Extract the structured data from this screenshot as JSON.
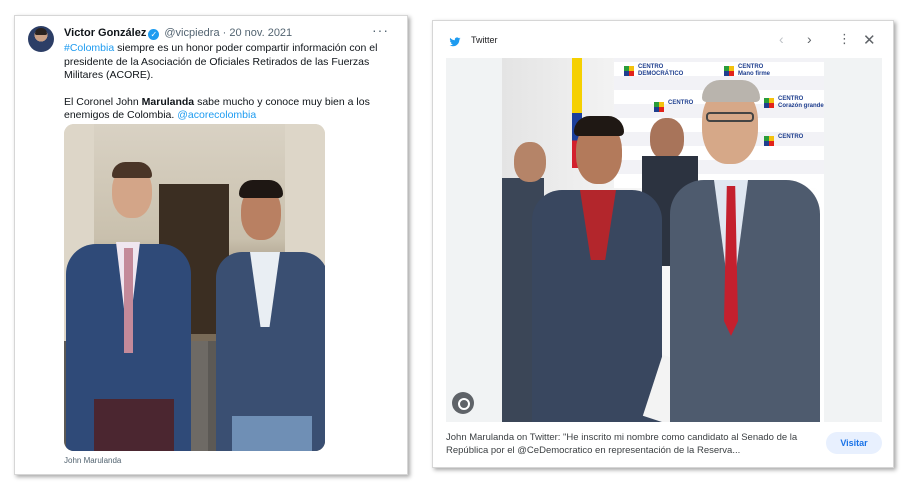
{
  "tweet": {
    "author_name": "Victor González",
    "handle": "@vicpiedra",
    "separator": " · ",
    "date": "20 nov. 2021",
    "more_label": "···",
    "paragraph1": {
      "hashtag": "#Colombia",
      "text": " siempre es un honor poder compartir información con el presidente de la Asociación de Oficiales Retirados de las Fuerzas Militares (ACORE)."
    },
    "paragraph2": {
      "pre": "El Coronel John ",
      "bold": "Marulanda",
      "post": " sabe mucho y conoce muy bien a los enemigos de Colombia. ",
      "mention": "@acorecolombia"
    },
    "photo_caption": "John Marulanda"
  },
  "viewer": {
    "source_label": "Twitter",
    "controls": {
      "prev": "‹",
      "next": "›",
      "menu": "⋮",
      "close": "✕"
    },
    "image_title": "John Marulanda on Twitter: \"He inscrito mi nombre como candidato al Senado de la República por el @CeDemocratico en representación de la Reserva...",
    "visit_label": "Visitar",
    "banner_lines": [
      "CENTRO",
      "DEMOCRÁTICO",
      "Mano firme",
      "Corazón grande"
    ]
  },
  "colors": {
    "link": "#1d9bf0",
    "verified": "#1d9bf0",
    "visit_bg": "#e8f0fe",
    "visit_text": "#1a73e8"
  },
  "icons": {
    "verified": "check-badge-icon",
    "twitter": "twitter-bird-icon",
    "lens": "google-lens-icon"
  }
}
